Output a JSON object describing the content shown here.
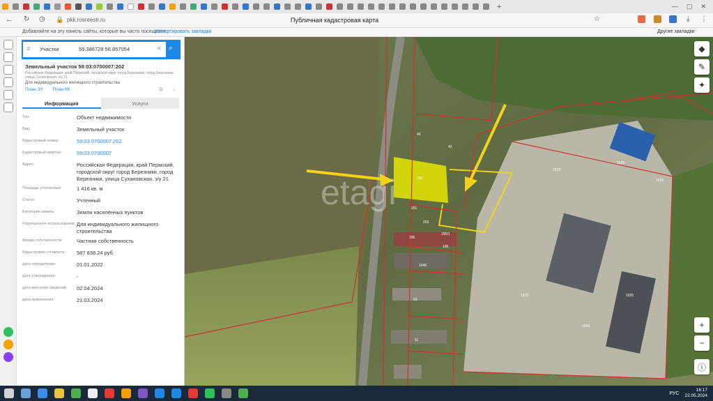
{
  "browser": {
    "url": "pkk.rosreestr.ru",
    "page_title": "Публичная кадастровая карта",
    "bookmark_hint": "Добавляйте на эту панель сайты, которые вы часто посещаете.",
    "bookmark_import": "Импортировать закладки",
    "other_bookmarks": "Другие закладки"
  },
  "search": {
    "category": "Участки",
    "query": "59.386728 56.857054"
  },
  "parcel": {
    "title": "Земельный участок 59:03:0700007:202",
    "address_short": "Российская Федерация, край Пермский, городской округ город Березники, город Березники, улица Сухановская, з/у 21",
    "usage": "Для индивидуального жилищного строительства",
    "plan_zu": "План ЗУ",
    "plan_kk": "План КК"
  },
  "tabs": {
    "info": "Информация",
    "services": "Услуги"
  },
  "fields": [
    {
      "label": "Тип:",
      "value": "Объект недвижимости",
      "link": false
    },
    {
      "label": "Вид:",
      "value": "Земельный участок",
      "link": false
    },
    {
      "label": "Кадастровый номер:",
      "value": "59:03:0700007:202",
      "link": true
    },
    {
      "label": "Кадастровый квартал:",
      "value": "59:03:0700007",
      "link": true
    },
    {
      "label": "Адрес:",
      "value": "Российская Федерация, край Пермский, городской округ город Березники, город Березники, улица Сухановская, з/у 21",
      "link": false
    },
    {
      "label": "Площадь уточненная:",
      "value": "1 416 кв. м",
      "link": false
    },
    {
      "label": "Статус:",
      "value": "Учтенный",
      "link": false
    },
    {
      "label": "Категория земель:",
      "value": "Земли населённых пунктов",
      "link": false
    },
    {
      "label": "Разрешенное использование:",
      "value": "Для индивидуального жилищного строительства",
      "link": false
    },
    {
      "label": "Форма собственности:",
      "value": "Частная собственность",
      "link": false
    },
    {
      "label": "Кадастровая стоимость:",
      "value": "587 838.24 руб.",
      "link": false
    },
    {
      "label": "дата определения:",
      "value": "01.01.2022",
      "link": false
    },
    {
      "label": "дата утверждения:",
      "value": "-",
      "link": false
    },
    {
      "label": "дата внесения сведений:",
      "value": "02.04.2024",
      "link": false
    },
    {
      "label": "дата применения:",
      "value": "21.03.2024",
      "link": false
    }
  ],
  "map_labels": [
    "202",
    "201",
    "203",
    "185",
    "195/1",
    "196",
    "1046",
    "63",
    "42",
    "43",
    "1570",
    "1525",
    "1526",
    "1570",
    "1525",
    "1526",
    "11"
  ],
  "taskbar": {
    "lang": "РУС",
    "time": "16:17",
    "date": "22.05.2024"
  },
  "colors": {
    "accent": "#1e88e5",
    "highlight": "#e6e600",
    "arrow": "#f2d21b",
    "boundary": "#d32f2f"
  }
}
